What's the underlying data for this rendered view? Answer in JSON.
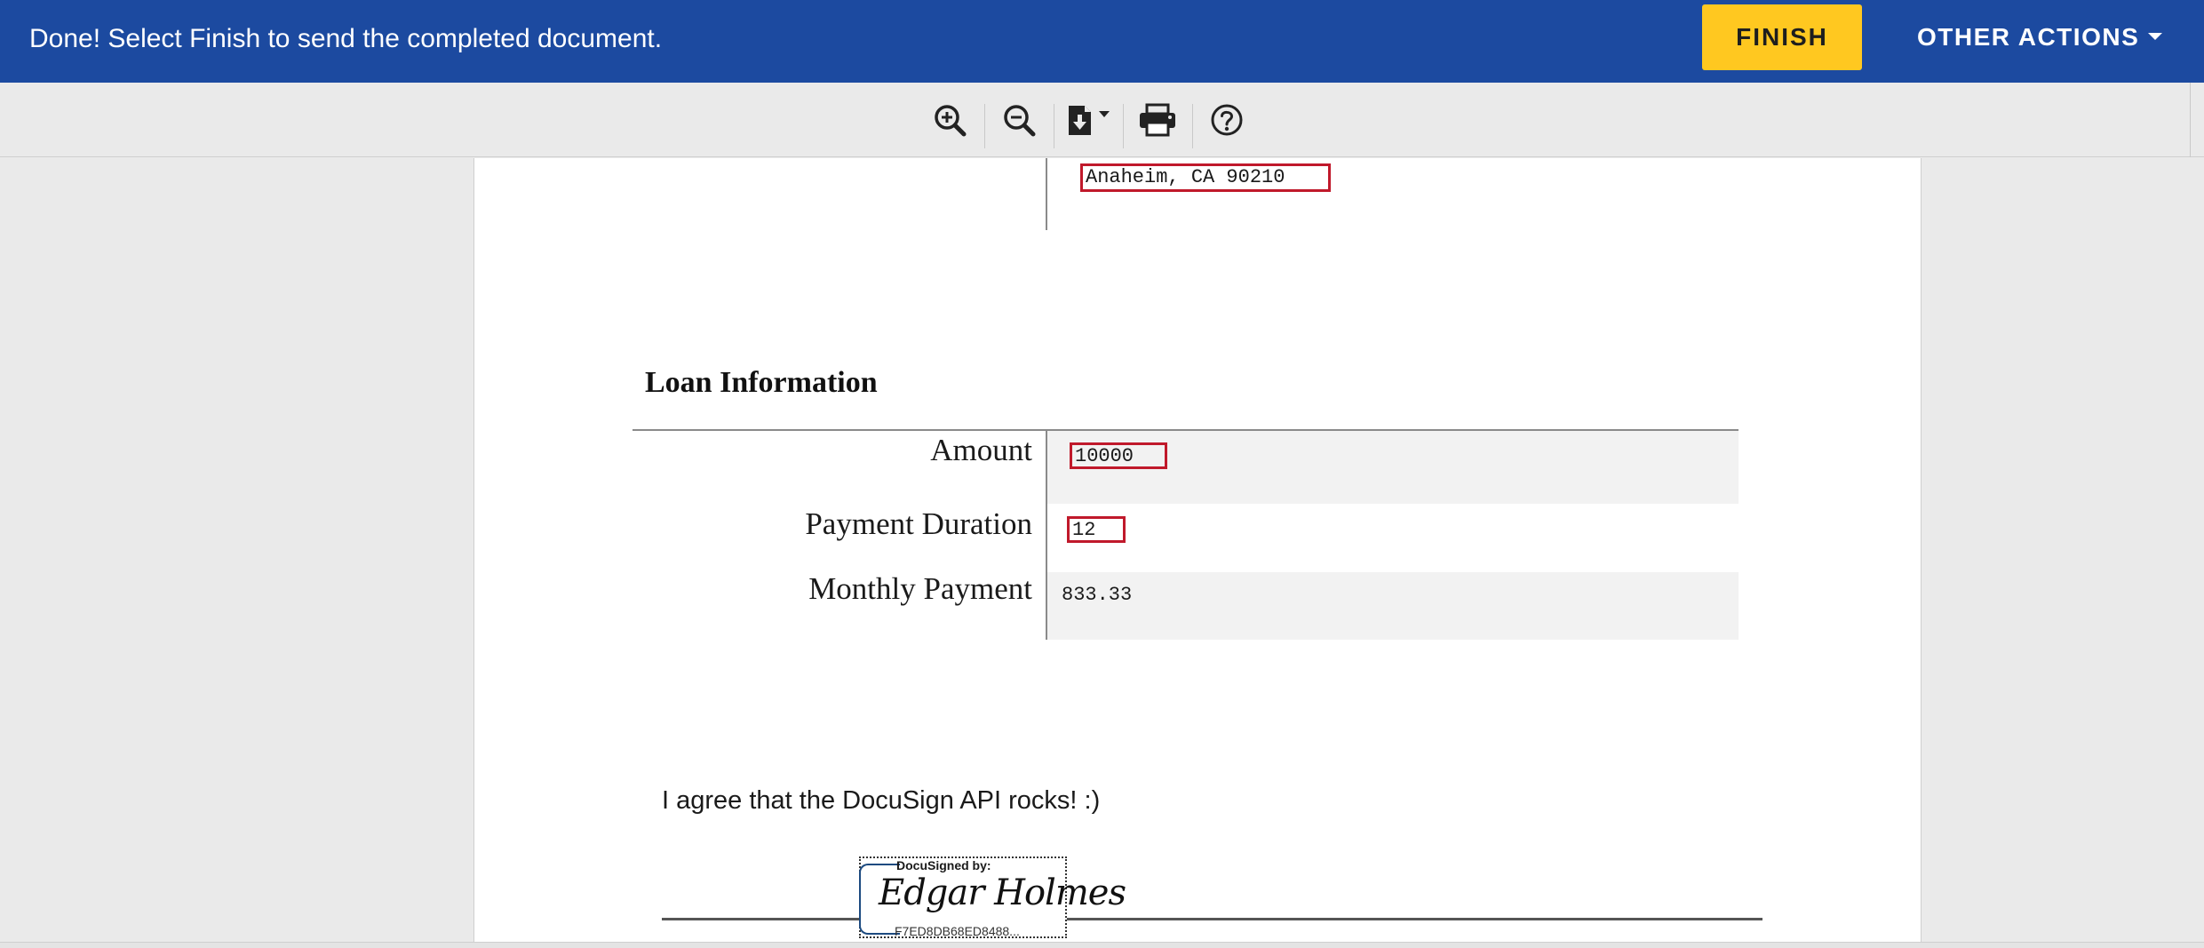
{
  "banner": {
    "message": "Done! Select Finish to send the completed document.",
    "finish_label": "FINISH",
    "other_actions_label": "OTHER ACTIONS",
    "background_color": "#1c4aa0",
    "finish_color": "#ffc820"
  },
  "toolbar": {
    "tools": [
      {
        "name": "zoom-in",
        "icon": "zoom-in-icon"
      },
      {
        "name": "zoom-out",
        "icon": "zoom-out-icon"
      },
      {
        "name": "download",
        "icon": "download-document-icon"
      },
      {
        "name": "print",
        "icon": "printer-icon"
      },
      {
        "name": "help",
        "icon": "help-circle-icon"
      }
    ]
  },
  "document": {
    "address_line": "Anaheim, CA 90210",
    "loan_section_title": "Loan Information",
    "loan_rows": [
      {
        "label": "Amount",
        "value": "10000",
        "editable": true
      },
      {
        "label": "Payment Duration",
        "value": "12",
        "editable": true
      },
      {
        "label": "Monthly Payment",
        "value": "833.33",
        "editable": false
      }
    ],
    "agreement_text": "I agree that the DocuSign API rocks! :)",
    "signature": {
      "header": "DocuSigned by:",
      "name": "Edgar Holmes",
      "id": "F7ED8DB68ED8488..."
    },
    "field_border_color": "#c0192b"
  }
}
